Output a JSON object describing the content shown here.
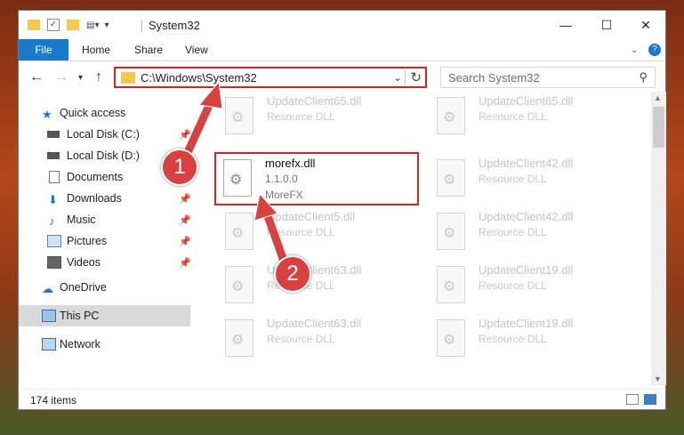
{
  "window": {
    "title": "System32",
    "minimize": "—",
    "maximize": "☐",
    "close": "✕"
  },
  "menu": {
    "file": "File",
    "home": "Home",
    "share": "Share",
    "view": "View"
  },
  "address": {
    "path": "C:\\Windows\\System32",
    "search_placeholder": "Search System32"
  },
  "sidebar": {
    "items": [
      {
        "label": "Quick access",
        "icon": "star-icon",
        "pinned": false
      },
      {
        "label": "Local Disk (C:)",
        "icon": "drive-icon",
        "pinned": true
      },
      {
        "label": "Local Disk (D:)",
        "icon": "drive-icon",
        "pinned": false
      },
      {
        "label": "Documents",
        "icon": "documents-icon",
        "pinned": true
      },
      {
        "label": "Downloads",
        "icon": "downloads-icon",
        "pinned": true
      },
      {
        "label": "Music",
        "icon": "music-icon",
        "pinned": true
      },
      {
        "label": "Pictures",
        "icon": "pictures-icon",
        "pinned": true
      },
      {
        "label": "Videos",
        "icon": "videos-icon",
        "pinned": true
      },
      {
        "label": "OneDrive",
        "icon": "cloud-icon",
        "pinned": false
      },
      {
        "label": "This PC",
        "icon": "pc-icon",
        "pinned": false
      },
      {
        "label": "Network",
        "icon": "network-icon",
        "pinned": false
      }
    ]
  },
  "files": [
    {
      "name": "UpdateClient65.dll",
      "type": "Resource DLL",
      "version": ""
    },
    {
      "name": "UpdateClient65.dll",
      "type": "Resource DLL",
      "version": ""
    },
    {
      "name": "morefx.dll",
      "type": "1.1.0.0",
      "version": "MoreFX"
    },
    {
      "name": "UpdateClient42.dll",
      "type": "Resource DLL",
      "version": ""
    },
    {
      "name": "UpdateClient5.dll",
      "type": "Resource DLL",
      "version": ""
    },
    {
      "name": "UpdateClient42.dll",
      "type": "Resource DLL",
      "version": ""
    },
    {
      "name": "UpdateClient63.dll",
      "type": "Resource DLL",
      "version": ""
    },
    {
      "name": "UpdateClient19.dll",
      "type": "Resource DLL",
      "version": ""
    },
    {
      "name": "UpdateClient63.dll",
      "type": "Resource DLL",
      "version": ""
    },
    {
      "name": "UpdateClient19.dll",
      "type": "Resource DLL",
      "version": ""
    }
  ],
  "status": {
    "item_count": "174 items"
  },
  "annotations": {
    "step1": "1",
    "step2": "2"
  },
  "colors": {
    "accent": "#1979ca",
    "highlight": "#e02020",
    "badge": "#d94040"
  }
}
